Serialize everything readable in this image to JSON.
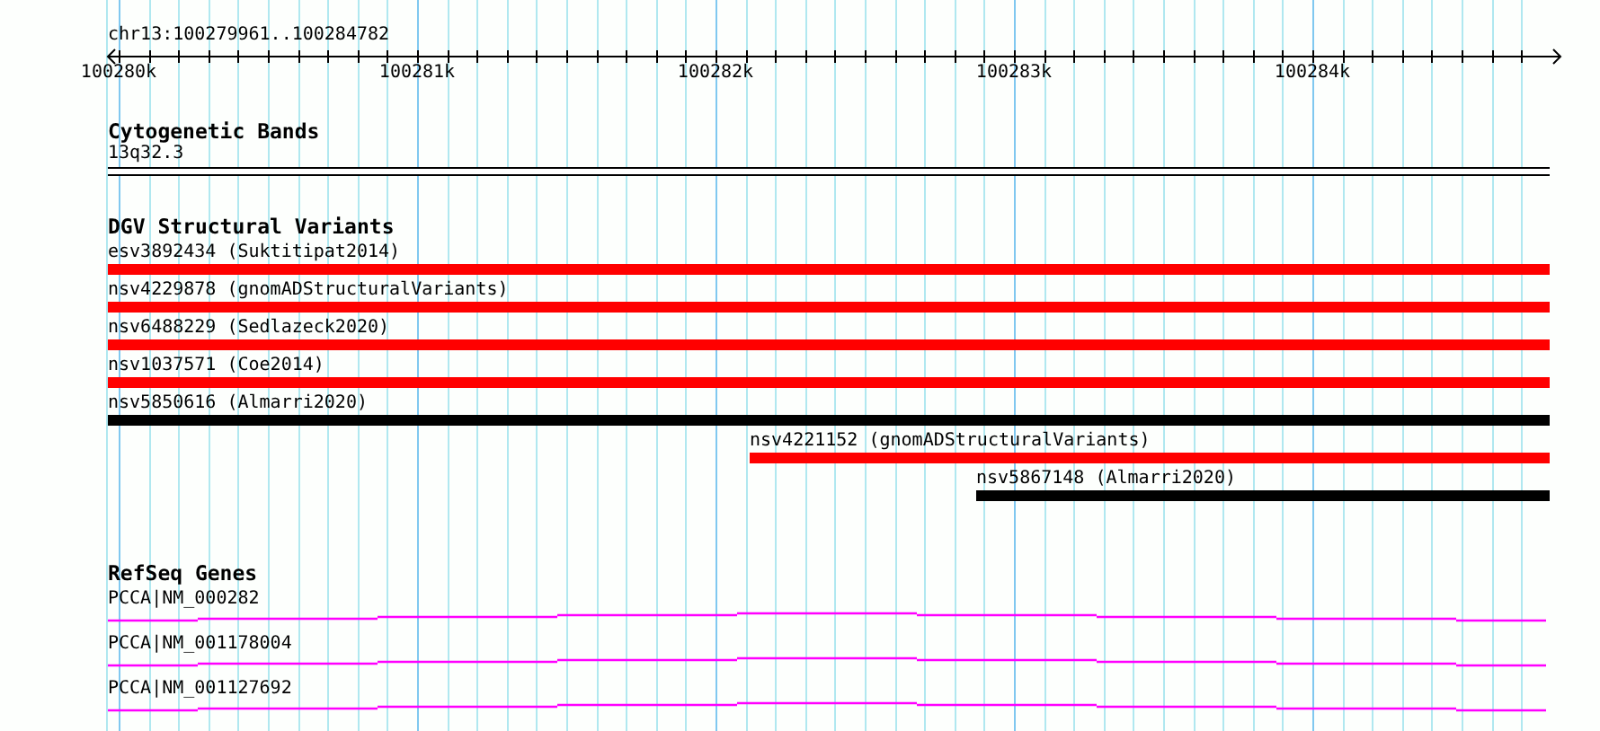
{
  "location": "chr13:100279961..100284782",
  "ruler": {
    "ticks": [
      "100280k",
      "100281k",
      "100282k",
      "100283k",
      "100284k"
    ]
  },
  "tracks": [
    {
      "kind": "bands",
      "title": "Cytogenetic Bands",
      "features": [
        {
          "label": "13q32.3"
        }
      ]
    },
    {
      "kind": "variants",
      "title": "DGV Structural Variants",
      "features": [
        {
          "label": "esv3892434 (Suktitipat2014)",
          "color": "#ff0000"
        },
        {
          "label": "nsv4229878 (gnomADStructuralVariants)",
          "color": "#ff0000"
        },
        {
          "label": "nsv6488229 (Sedlazeck2020)",
          "color": "#ff0000"
        },
        {
          "label": "nsv1037571 (Coe2014)",
          "color": "#ff0000"
        },
        {
          "label": "nsv5850616 (Almarri2020)",
          "color": "#000000"
        },
        {
          "label": "nsv4221152 (gnomADStructuralVariants)",
          "color": "#ff0000"
        },
        {
          "label": "nsv5867148 (Almarri2020)",
          "color": "#000000"
        }
      ]
    },
    {
      "kind": "genes",
      "title": "RefSeq Genes",
      "features": [
        {
          "label": "PCCA|NM_000282"
        },
        {
          "label": "PCCA|NM_001178004"
        },
        {
          "label": "PCCA|NM_001127692"
        }
      ]
    }
  ]
}
